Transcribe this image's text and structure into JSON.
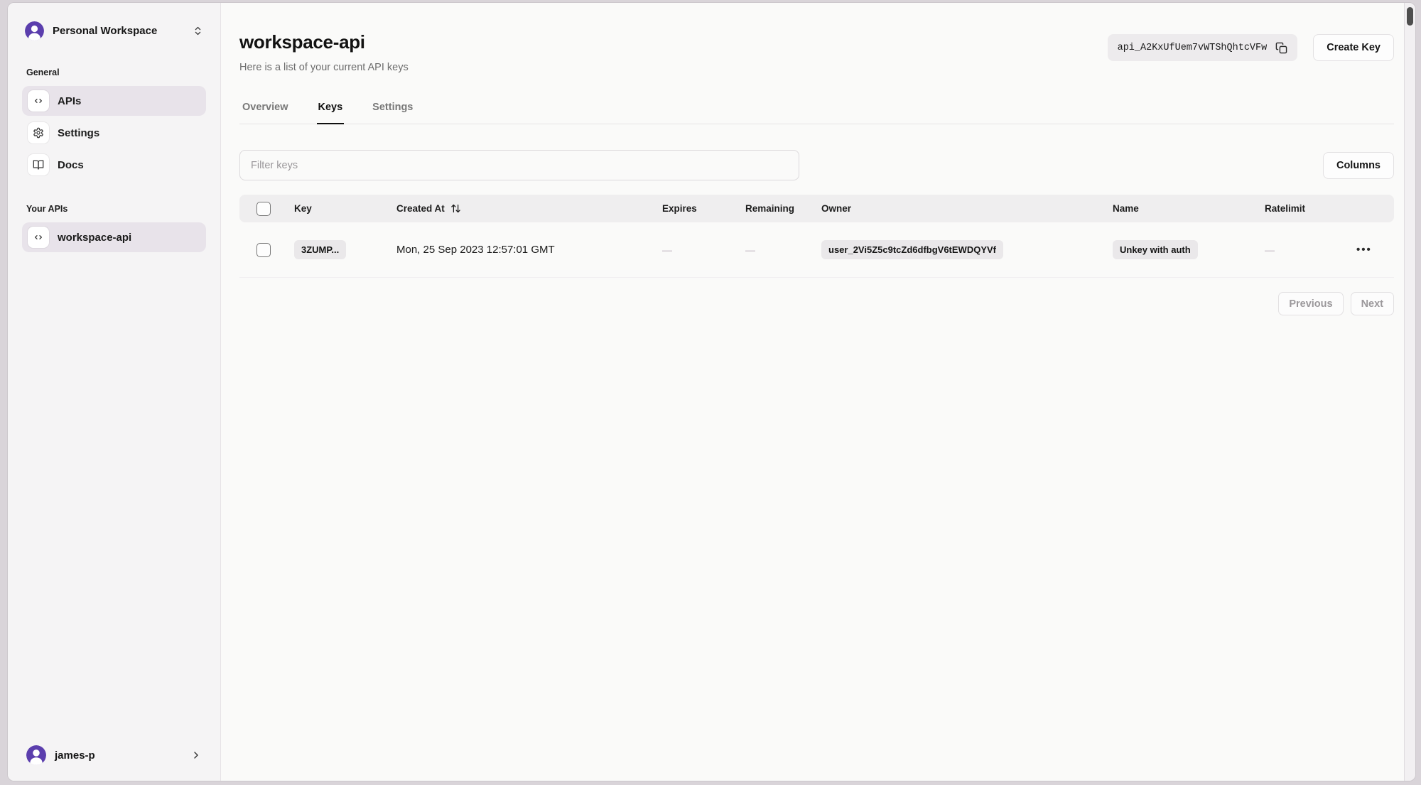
{
  "sidebar": {
    "workspace": {
      "name": "Personal Workspace",
      "icon": "avatar-icon"
    },
    "sections": [
      {
        "label": "General",
        "items": [
          {
            "label": "APIs",
            "icon": "code-icon",
            "active": true
          },
          {
            "label": "Settings",
            "icon": "gear-icon",
            "active": false
          },
          {
            "label": "Docs",
            "icon": "book-icon",
            "active": false
          }
        ]
      },
      {
        "label": "Your APIs",
        "items": [
          {
            "label": "workspace-api",
            "icon": "code-icon",
            "active": true
          }
        ]
      }
    ],
    "user": {
      "name": "james-p",
      "icon": "avatar-icon"
    }
  },
  "header": {
    "title": "workspace-api",
    "subtitle": "Here is a list of your current API keys",
    "api_key": "api_A2KxUfUem7vWTShQhtcVFw",
    "copy_icon": "copy-icon",
    "create_key_label": "Create Key"
  },
  "tabs": [
    {
      "label": "Overview",
      "active": false
    },
    {
      "label": "Keys",
      "active": true
    },
    {
      "label": "Settings",
      "active": false
    }
  ],
  "toolbar": {
    "filter_placeholder": "Filter keys",
    "columns_label": "Columns"
  },
  "table": {
    "columns": [
      "Key",
      "Created At",
      "Expires",
      "Remaining",
      "Owner",
      "Name",
      "Ratelimit"
    ],
    "sorted_column": "Created At",
    "sort_icon": "arrow-up-down-icon",
    "rows": [
      {
        "key": "3ZUMP...",
        "created_at": "Mon, 25 Sep 2023 12:57:01 GMT",
        "expires": "—",
        "remaining": "—",
        "owner": "user_2Vi5Z5c9tcZd6dfbgV6tEWDQYVf",
        "name": "Unkey with auth",
        "ratelimit": "—",
        "menu_icon": "ellipsis-icon"
      }
    ]
  },
  "pagination": {
    "previous_label": "Previous",
    "next_label": "Next"
  },
  "colors": {
    "accent_purple": "#5b3ead",
    "sidebar_bg": "#f5f4f5",
    "active_item_bg": "#e8e3ea",
    "table_header_bg": "#efeeef",
    "badge_bg": "#eae8ea"
  }
}
